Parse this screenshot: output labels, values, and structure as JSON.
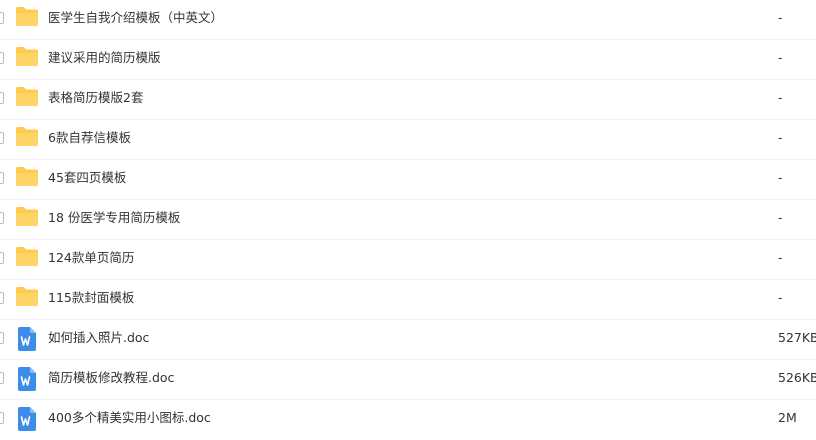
{
  "colors": {
    "folder": "#FFC94D",
    "word": "#3C8CEA"
  },
  "files": [
    {
      "name": "医学生自我介绍模板（中英文）",
      "size": "-",
      "icon": "folder-icon"
    },
    {
      "name": "建议采用的简历模版",
      "size": "-",
      "icon": "folder-icon"
    },
    {
      "name": "表格简历模版2套",
      "size": "-",
      "icon": "folder-icon"
    },
    {
      "name": "6款自荐信模板",
      "size": "-",
      "icon": "folder-icon"
    },
    {
      "name": "45套四页模板",
      "size": "-",
      "icon": "folder-icon"
    },
    {
      "name": "18 份医学专用简历模板",
      "size": "-",
      "icon": "folder-icon"
    },
    {
      "name": "124款单页简历",
      "size": "-",
      "icon": "folder-icon"
    },
    {
      "name": "115款封面模板",
      "size": "-",
      "icon": "folder-icon"
    },
    {
      "name": "如何插入照片.doc",
      "size": "527KB",
      "icon": "word-doc-icon"
    },
    {
      "name": "简历模板修改教程.doc",
      "size": "526KB",
      "icon": "word-doc-icon"
    },
    {
      "name": "400多个精美实用小图标.doc",
      "size": "2M",
      "icon": "word-doc-icon"
    }
  ]
}
